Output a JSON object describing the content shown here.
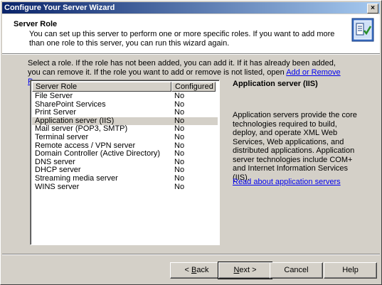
{
  "window": {
    "title": "Configure Your Server Wizard",
    "close_label": "×"
  },
  "header": {
    "title": "Server Role",
    "description": "You can set up this server to perform one or more specific roles. If you want to add more than one role to this server, you can run this wizard again."
  },
  "intro": {
    "text": "Select a role. If the role has not been added, you can add it. If it has already been added, you can remove it. If the role you want to add or remove is not listed, open ",
    "link": "Add or Remove Programs",
    "suffix": "."
  },
  "table": {
    "columns": [
      "Server Role",
      "Configured"
    ],
    "rows": [
      [
        "File Server",
        "No"
      ],
      [
        "SharePoint Services",
        "No"
      ],
      [
        "Print Server",
        "No"
      ],
      [
        "Application server (IIS)",
        "No"
      ],
      [
        "Mail server (POP3, SMTP)",
        "No"
      ],
      [
        "Terminal server",
        "No"
      ],
      [
        "Remote access / VPN server",
        "No"
      ],
      [
        "Domain Controller (Active Directory)",
        "No"
      ],
      [
        "DNS server",
        "No"
      ],
      [
        "DHCP server",
        "No"
      ],
      [
        "Streaming media server",
        "No"
      ],
      [
        "WINS server",
        "No"
      ]
    ],
    "selected_index": 3
  },
  "detail": {
    "title": "Application server (IIS)",
    "description": "Application servers provide the core technologies required to build, deploy, and operate XML Web Services, Web applications, and distributed applications. Application server technologies include COM+ and Internet Information Services (IIS).",
    "link": "Read about application servers"
  },
  "buttons": {
    "back": {
      "pre": "< ",
      "accel": "B",
      "post": "ack"
    },
    "next": {
      "accel": "N",
      "post": "ext >"
    },
    "cancel": "Cancel",
    "help": "Help"
  },
  "icons": {
    "wizard": "wizard-icon",
    "close": "close-icon"
  }
}
